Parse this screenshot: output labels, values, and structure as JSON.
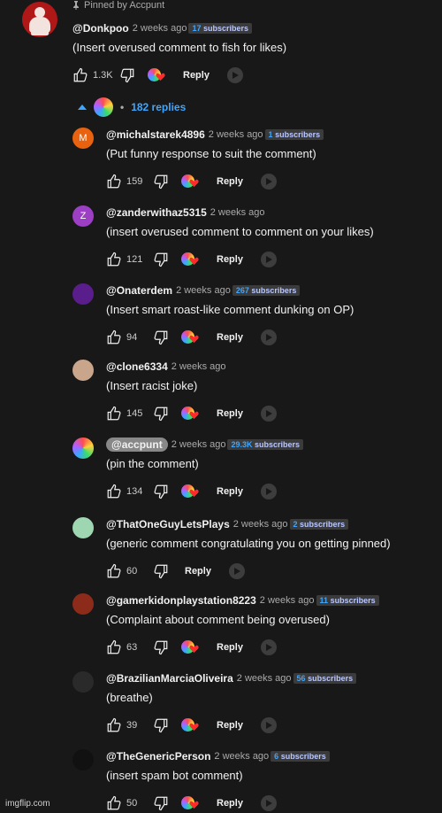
{
  "pinned_label": "Pinned by Accpunt",
  "top_comment": {
    "author": "@Donkpoo",
    "time": "2 weeks ago",
    "badge_num": "17",
    "badge_text": "subscribers",
    "text": "(Insert overused comment to fish for likes)",
    "likes": "1.3K",
    "reply_label": "Reply"
  },
  "replies_toggle": "182 replies",
  "replies": [
    {
      "author": "@michalstarek4896",
      "time": "2 weeks ago",
      "badge_num": "1",
      "badge_text": "subscribers",
      "text": "(Put funny response to suit the comment)",
      "likes": "159",
      "reply_label": "Reply",
      "avatar_letter": "M",
      "avatar_color": "#e8620f",
      "heart": true
    },
    {
      "author": "@zanderwithaz5315",
      "time": "2 weeks ago",
      "badge_num": "",
      "badge_text": "",
      "text": "(insert overused comment to comment on your likes)",
      "likes": "121",
      "reply_label": "Reply",
      "avatar_letter": "Z",
      "avatar_color": "#9c3fc4",
      "heart": true
    },
    {
      "author": "@Onaterdem",
      "time": "2 weeks ago",
      "badge_num": "267",
      "badge_text": "subscribers",
      "text": "(Insert smart roast-like comment dunking on OP)",
      "likes": "94",
      "reply_label": "Reply",
      "avatar_letter": "",
      "avatar_color": "#5a1d8c",
      "heart": true
    },
    {
      "author": "@clone6334",
      "time": "2 weeks ago",
      "badge_num": "",
      "badge_text": "",
      "text": "(Insert racist joke)",
      "likes": "145",
      "reply_label": "Reply",
      "avatar_letter": "",
      "avatar_color": "#c9a58c",
      "heart": true
    },
    {
      "author": "@accpunt",
      "time": "2 weeks ago",
      "badge_num": "29.3K",
      "badge_text": "subscribers",
      "text": "(pin the comment)",
      "likes": "134",
      "reply_label": "Reply",
      "avatar_letter": "",
      "avatar_color": "#ffd23a",
      "heart": true,
      "is_owner": true
    },
    {
      "author": "@ThatOneGuyLetsPlays",
      "time": "2 weeks ago",
      "badge_num": "2",
      "badge_text": "subscribers",
      "text": "(generic comment congratulating you on getting pinned)",
      "likes": "60",
      "reply_label": "Reply",
      "avatar_letter": "",
      "avatar_color": "#9fd6b2",
      "heart": false
    },
    {
      "author": "@gamerkidonplaystation8223",
      "time": "2 weeks ago",
      "badge_num": "11",
      "badge_text": "subscribers",
      "text": "(Complaint about comment being overused)",
      "likes": "63",
      "reply_label": "Reply",
      "avatar_letter": "",
      "avatar_color": "#8c2b1a",
      "heart": true
    },
    {
      "author": "@BrazilianMarciaOliveira",
      "time": "2 weeks ago",
      "badge_num": "56",
      "badge_text": "subscribers",
      "text": "(breathe)",
      "likes": "39",
      "reply_label": "Reply",
      "avatar_letter": "",
      "avatar_color": "#2a2a2a",
      "heart": true
    },
    {
      "author": "@TheGenericPerson",
      "time": "2 weeks ago",
      "badge_num": "6",
      "badge_text": "subscribers",
      "text": "(insert spam bot comment)",
      "likes": "50",
      "reply_label": "Reply",
      "avatar_letter": "",
      "avatar_color": "#111111",
      "heart": true
    }
  ],
  "watermark": "imgflip.com",
  "colors": {
    "background": "#181818",
    "link": "#3ea6ff",
    "heart": "#ff2a2a"
  }
}
